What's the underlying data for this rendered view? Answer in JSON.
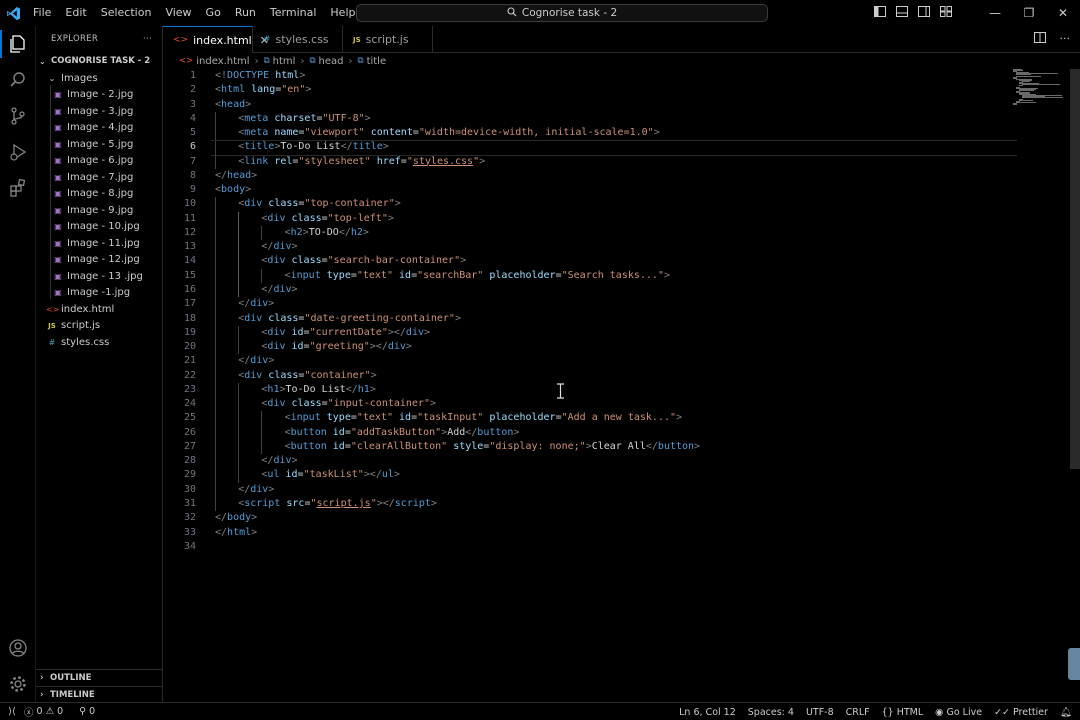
{
  "titlebar": {
    "menu": [
      "File",
      "Edit",
      "Selection",
      "View",
      "Go",
      "Run",
      "Terminal",
      "Help"
    ],
    "command_center": "Cognorise task - 2"
  },
  "sidebar": {
    "header": "EXPLORER",
    "more": "···",
    "root_folder": "COGNORISE TASK - 2",
    "subfolder": "Images",
    "images": [
      "Image - 2.jpg",
      "Image - 3.jpg",
      "Image - 4.jpg",
      "Image - 5.jpg",
      "Image - 6.jpg",
      "Image - 7.jpg",
      "Image - 8.jpg",
      "Image - 9.jpg",
      "Image - 10.jpg",
      "Image - 11.jpg",
      "Image - 12.jpg",
      "Image - 13 .jpg",
      "Image -1.jpg"
    ],
    "files": [
      {
        "name": "index.html",
        "type": "html"
      },
      {
        "name": "script.js",
        "type": "js"
      },
      {
        "name": "styles.css",
        "type": "css"
      }
    ],
    "outline": "OUTLINE",
    "timeline": "TIMELINE"
  },
  "tabs": [
    {
      "label": "index.html",
      "type": "html",
      "active": true
    },
    {
      "label": "styles.css",
      "type": "css",
      "active": false
    },
    {
      "label": "script.js",
      "type": "js",
      "active": false
    }
  ],
  "breadcrumb": [
    "index.html",
    "html",
    "head",
    "title"
  ],
  "code": {
    "current_line": 6,
    "lines": [
      {
        "n": 1,
        "indent": 0,
        "tokens": [
          [
            "tg",
            "<!"
          ],
          [
            "tn",
            "DOCTYPE"
          ],
          [
            "at",
            " html"
          ],
          [
            "tg",
            ">"
          ]
        ]
      },
      {
        "n": 2,
        "indent": 0,
        "tokens": [
          [
            "tg",
            "<"
          ],
          [
            "tn",
            "html"
          ],
          [
            "at",
            " lang"
          ],
          [
            "tx",
            "="
          ],
          [
            "st",
            "\"en\""
          ],
          [
            "tg",
            ">"
          ]
        ]
      },
      {
        "n": 3,
        "indent": 0,
        "tokens": [
          [
            "tg",
            "<"
          ],
          [
            "tn",
            "head"
          ],
          [
            "tg",
            ">"
          ]
        ]
      },
      {
        "n": 4,
        "indent": 1,
        "tokens": [
          [
            "tg",
            "<"
          ],
          [
            "tn",
            "meta"
          ],
          [
            "at",
            " charset"
          ],
          [
            "tx",
            "="
          ],
          [
            "st",
            "\"UTF-8\""
          ],
          [
            "tg",
            ">"
          ]
        ]
      },
      {
        "n": 5,
        "indent": 1,
        "tokens": [
          [
            "tg",
            "<"
          ],
          [
            "tn",
            "meta"
          ],
          [
            "at",
            " name"
          ],
          [
            "tx",
            "="
          ],
          [
            "st",
            "\"viewport\""
          ],
          [
            "at",
            " content"
          ],
          [
            "tx",
            "="
          ],
          [
            "st",
            "\"width=device-width, initial-scale=1.0\""
          ],
          [
            "tg",
            ">"
          ]
        ]
      },
      {
        "n": 6,
        "indent": 1,
        "tokens": [
          [
            "tg",
            "<"
          ],
          [
            "tn",
            "title"
          ],
          [
            "tg",
            ">"
          ],
          [
            "tx",
            "To-Do List"
          ],
          [
            "tg",
            "</"
          ],
          [
            "tn",
            "title"
          ],
          [
            "tg",
            ">"
          ]
        ]
      },
      {
        "n": 7,
        "indent": 1,
        "tokens": [
          [
            "tg",
            "<"
          ],
          [
            "tn",
            "link"
          ],
          [
            "at",
            " rel"
          ],
          [
            "tx",
            "="
          ],
          [
            "st",
            "\"stylesheet\""
          ],
          [
            "at",
            " href"
          ],
          [
            "tx",
            "="
          ],
          [
            "st",
            "\""
          ],
          [
            "stu",
            "styles.css"
          ],
          [
            "st",
            "\""
          ],
          [
            "tg",
            ">"
          ]
        ]
      },
      {
        "n": 8,
        "indent": 0,
        "tokens": [
          [
            "tg",
            "</"
          ],
          [
            "tn",
            "head"
          ],
          [
            "tg",
            ">"
          ]
        ]
      },
      {
        "n": 9,
        "indent": 0,
        "tokens": [
          [
            "tg",
            "<"
          ],
          [
            "tn",
            "body"
          ],
          [
            "tg",
            ">"
          ]
        ]
      },
      {
        "n": 10,
        "indent": 1,
        "tokens": [
          [
            "tg",
            "<"
          ],
          [
            "tn",
            "div"
          ],
          [
            "at",
            " class"
          ],
          [
            "tx",
            "="
          ],
          [
            "st",
            "\"top-container\""
          ],
          [
            "tg",
            ">"
          ]
        ]
      },
      {
        "n": 11,
        "indent": 2,
        "tokens": [
          [
            "tg",
            "<"
          ],
          [
            "tn",
            "div"
          ],
          [
            "at",
            " class"
          ],
          [
            "tx",
            "="
          ],
          [
            "st",
            "\"top-left\""
          ],
          [
            "tg",
            ">"
          ]
        ]
      },
      {
        "n": 12,
        "indent": 3,
        "tokens": [
          [
            "tg",
            "<"
          ],
          [
            "tn",
            "h2"
          ],
          [
            "tg",
            ">"
          ],
          [
            "tx",
            "TO-DO"
          ],
          [
            "tg",
            "</"
          ],
          [
            "tn",
            "h2"
          ],
          [
            "tg",
            ">"
          ]
        ]
      },
      {
        "n": 13,
        "indent": 2,
        "tokens": [
          [
            "tg",
            "</"
          ],
          [
            "tn",
            "div"
          ],
          [
            "tg",
            ">"
          ]
        ]
      },
      {
        "n": 14,
        "indent": 2,
        "tokens": [
          [
            "tg",
            "<"
          ],
          [
            "tn",
            "div"
          ],
          [
            "at",
            " class"
          ],
          [
            "tx",
            "="
          ],
          [
            "st",
            "\"search-bar-container\""
          ],
          [
            "tg",
            ">"
          ]
        ]
      },
      {
        "n": 15,
        "indent": 3,
        "tokens": [
          [
            "tg",
            "<"
          ],
          [
            "tn",
            "input"
          ],
          [
            "at",
            " type"
          ],
          [
            "tx",
            "="
          ],
          [
            "st",
            "\"text\""
          ],
          [
            "at",
            " id"
          ],
          [
            "tx",
            "="
          ],
          [
            "st",
            "\"searchBar\""
          ],
          [
            "at",
            " placeholder"
          ],
          [
            "tx",
            "="
          ],
          [
            "st",
            "\"Search tasks...\""
          ],
          [
            "tg",
            ">"
          ]
        ]
      },
      {
        "n": 16,
        "indent": 2,
        "tokens": [
          [
            "tg",
            "</"
          ],
          [
            "tn",
            "div"
          ],
          [
            "tg",
            ">"
          ]
        ]
      },
      {
        "n": 17,
        "indent": 1,
        "tokens": [
          [
            "tg",
            "</"
          ],
          [
            "tn",
            "div"
          ],
          [
            "tg",
            ">"
          ]
        ]
      },
      {
        "n": 18,
        "indent": 1,
        "tokens": [
          [
            "tg",
            "<"
          ],
          [
            "tn",
            "div"
          ],
          [
            "at",
            " class"
          ],
          [
            "tx",
            "="
          ],
          [
            "st",
            "\"date-greeting-container\""
          ],
          [
            "tg",
            ">"
          ]
        ]
      },
      {
        "n": 19,
        "indent": 2,
        "tokens": [
          [
            "tg",
            "<"
          ],
          [
            "tn",
            "div"
          ],
          [
            "at",
            " id"
          ],
          [
            "tx",
            "="
          ],
          [
            "st",
            "\"currentDate\""
          ],
          [
            "tg",
            "></"
          ],
          [
            "tn",
            "div"
          ],
          [
            "tg",
            ">"
          ]
        ]
      },
      {
        "n": 20,
        "indent": 2,
        "tokens": [
          [
            "tg",
            "<"
          ],
          [
            "tn",
            "div"
          ],
          [
            "at",
            " id"
          ],
          [
            "tx",
            "="
          ],
          [
            "st",
            "\"greeting\""
          ],
          [
            "tg",
            "></"
          ],
          [
            "tn",
            "div"
          ],
          [
            "tg",
            ">"
          ]
        ]
      },
      {
        "n": 21,
        "indent": 1,
        "tokens": [
          [
            "tg",
            "</"
          ],
          [
            "tn",
            "div"
          ],
          [
            "tg",
            ">"
          ]
        ]
      },
      {
        "n": 22,
        "indent": 1,
        "tokens": [
          [
            "tg",
            "<"
          ],
          [
            "tn",
            "div"
          ],
          [
            "at",
            " class"
          ],
          [
            "tx",
            "="
          ],
          [
            "st",
            "\"container\""
          ],
          [
            "tg",
            ">"
          ]
        ]
      },
      {
        "n": 23,
        "indent": 2,
        "tokens": [
          [
            "tg",
            "<"
          ],
          [
            "tn",
            "h1"
          ],
          [
            "tg",
            ">"
          ],
          [
            "tx",
            "To-Do List"
          ],
          [
            "tg",
            "</"
          ],
          [
            "tn",
            "h1"
          ],
          [
            "tg",
            ">"
          ]
        ]
      },
      {
        "n": 24,
        "indent": 2,
        "tokens": [
          [
            "tg",
            "<"
          ],
          [
            "tn",
            "div"
          ],
          [
            "at",
            " class"
          ],
          [
            "tx",
            "="
          ],
          [
            "st",
            "\"input-container\""
          ],
          [
            "tg",
            ">"
          ]
        ]
      },
      {
        "n": 25,
        "indent": 3,
        "tokens": [
          [
            "tg",
            "<"
          ],
          [
            "tn",
            "input"
          ],
          [
            "at",
            " type"
          ],
          [
            "tx",
            "="
          ],
          [
            "st",
            "\"text\""
          ],
          [
            "at",
            " id"
          ],
          [
            "tx",
            "="
          ],
          [
            "st",
            "\"taskInput\""
          ],
          [
            "at",
            " placeholder"
          ],
          [
            "tx",
            "="
          ],
          [
            "st",
            "\"Add a new task...\""
          ],
          [
            "tg",
            ">"
          ]
        ]
      },
      {
        "n": 26,
        "indent": 3,
        "tokens": [
          [
            "tg",
            "<"
          ],
          [
            "tn",
            "button"
          ],
          [
            "at",
            " id"
          ],
          [
            "tx",
            "="
          ],
          [
            "st",
            "\"addTaskButton\""
          ],
          [
            "tg",
            ">"
          ],
          [
            "tx",
            "Add"
          ],
          [
            "tg",
            "</"
          ],
          [
            "tn",
            "button"
          ],
          [
            "tg",
            ">"
          ]
        ]
      },
      {
        "n": 27,
        "indent": 3,
        "tokens": [
          [
            "tg",
            "<"
          ],
          [
            "tn",
            "button"
          ],
          [
            "at",
            " id"
          ],
          [
            "tx",
            "="
          ],
          [
            "st",
            "\"clearAllButton\""
          ],
          [
            "at",
            " style"
          ],
          [
            "tx",
            "="
          ],
          [
            "st",
            "\"display: none;\""
          ],
          [
            "tg",
            ">"
          ],
          [
            "tx",
            "Clear All"
          ],
          [
            "tg",
            "</"
          ],
          [
            "tn",
            "button"
          ],
          [
            "tg",
            ">"
          ]
        ]
      },
      {
        "n": 28,
        "indent": 2,
        "tokens": [
          [
            "tg",
            "</"
          ],
          [
            "tn",
            "div"
          ],
          [
            "tg",
            ">"
          ]
        ]
      },
      {
        "n": 29,
        "indent": 2,
        "tokens": [
          [
            "tg",
            "<"
          ],
          [
            "tn",
            "ul"
          ],
          [
            "at",
            " id"
          ],
          [
            "tx",
            "="
          ],
          [
            "st",
            "\"taskList\""
          ],
          [
            "tg",
            "></"
          ],
          [
            "tn",
            "ul"
          ],
          [
            "tg",
            ">"
          ]
        ]
      },
      {
        "n": 30,
        "indent": 1,
        "tokens": [
          [
            "tg",
            "</"
          ],
          [
            "tn",
            "div"
          ],
          [
            "tg",
            ">"
          ]
        ]
      },
      {
        "n": 31,
        "indent": 1,
        "tokens": [
          [
            "tg",
            "<"
          ],
          [
            "tn",
            "script"
          ],
          [
            "at",
            " src"
          ],
          [
            "tx",
            "="
          ],
          [
            "st",
            "\""
          ],
          [
            "stu",
            "script.js"
          ],
          [
            "st",
            "\""
          ],
          [
            "tg",
            "></"
          ],
          [
            "tn",
            "script"
          ],
          [
            "tg",
            ">"
          ]
        ]
      },
      {
        "n": 32,
        "indent": 0,
        "tokens": [
          [
            "tg",
            "</"
          ],
          [
            "tn",
            "body"
          ],
          [
            "tg",
            ">"
          ]
        ]
      },
      {
        "n": 33,
        "indent": 0,
        "tokens": [
          [
            "tg",
            "</"
          ],
          [
            "tn",
            "html"
          ],
          [
            "tg",
            ">"
          ]
        ]
      },
      {
        "n": 34,
        "indent": 0,
        "tokens": []
      }
    ]
  },
  "status": {
    "errors": "0",
    "warnings": "0",
    "ports": "0",
    "position": "Ln 6, Col 12",
    "spaces": "Spaces: 4",
    "encoding": "UTF-8",
    "eol": "CRLF",
    "language": "HTML",
    "golive": "Go Live",
    "prettier": "Prettier"
  },
  "colors": {
    "accent": "#0078d4",
    "tag": "#569cd6",
    "attr": "#9cdcfe",
    "string": "#ce9178",
    "bracket": "#808080"
  }
}
